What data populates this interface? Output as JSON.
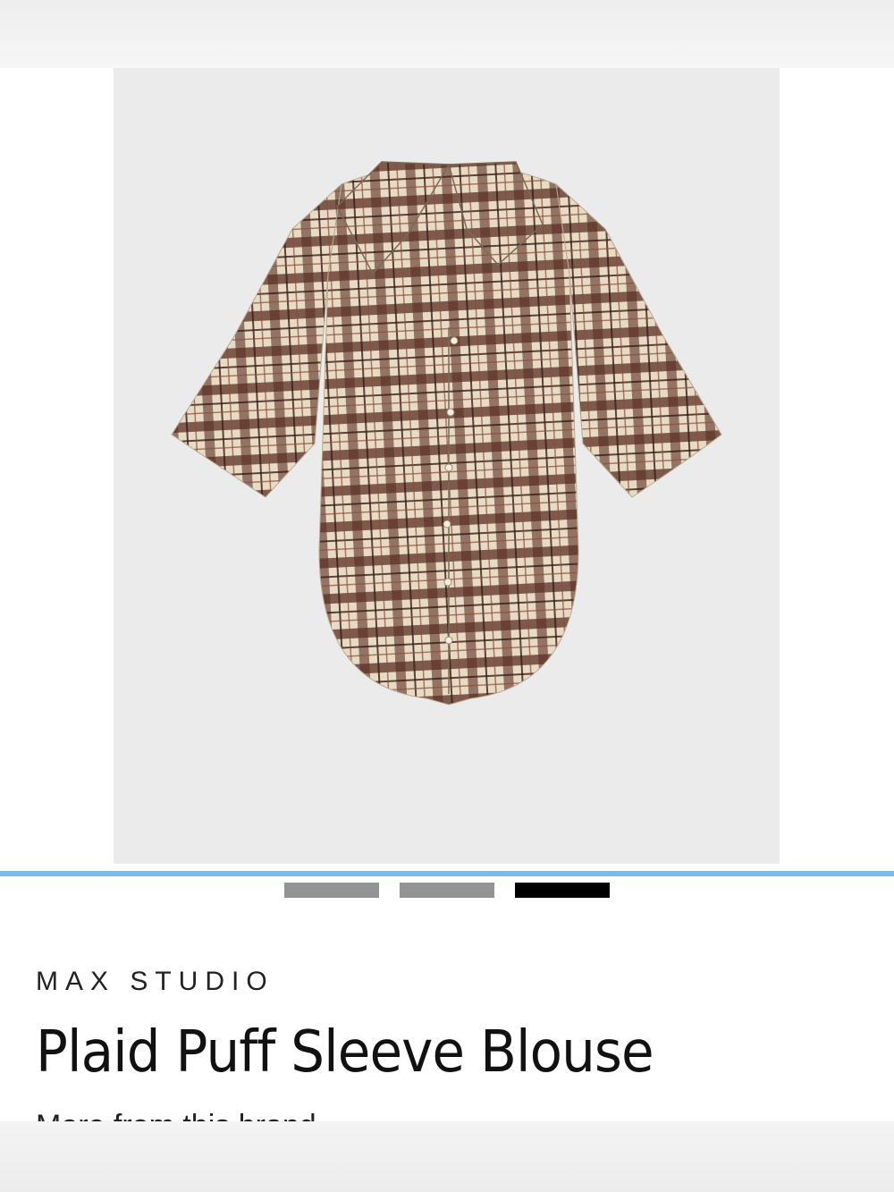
{
  "product": {
    "brand": "MAX STUDIO",
    "title": "Plaid Puff Sleeve Blouse",
    "more_from_brand": "More from this brand"
  },
  "gallery": {
    "image_count": 3,
    "active_index": 2,
    "zoom_icon": "search-icon"
  },
  "colors": {
    "background": "#ffffff",
    "image_bg": "#ebebeb",
    "accent_line": "#7db9e6",
    "plaid_brown": "#5a2e24",
    "plaid_cream": "#e9dcc6"
  }
}
